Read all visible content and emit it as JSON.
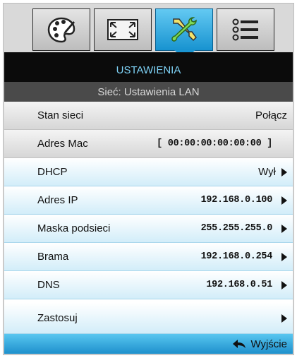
{
  "tabs": [
    {
      "icon": "palette-icon"
    },
    {
      "icon": "screen-expand-icon"
    },
    {
      "icon": "tools-icon",
      "active": true
    },
    {
      "icon": "list-icon"
    }
  ],
  "header": {
    "title": "USTAWIENIA",
    "subtitle": "Sieć: Ustawienia LAN"
  },
  "rows": [
    {
      "label": "Stan sieci",
      "value": "Połącz"
    },
    {
      "label": "Adres Mac",
      "value": "[ 00:00:00:00:00:00 ]"
    },
    {
      "label": "DHCP",
      "value": "Wył"
    },
    {
      "label": "Adres IP",
      "value": "192.168.0.100"
    },
    {
      "label": "Maska podsieci",
      "value": "255.255.255.0"
    },
    {
      "label": "Brama",
      "value": "192.168.0.254"
    },
    {
      "label": "DNS",
      "value": "192.168.0.51"
    },
    {
      "label": "Zastosuj",
      "value": ""
    }
  ],
  "footer": {
    "exit_label": "Wyjście"
  },
  "colors": {
    "accent": "#1b95d2",
    "title_text": "#7fd3f7"
  }
}
